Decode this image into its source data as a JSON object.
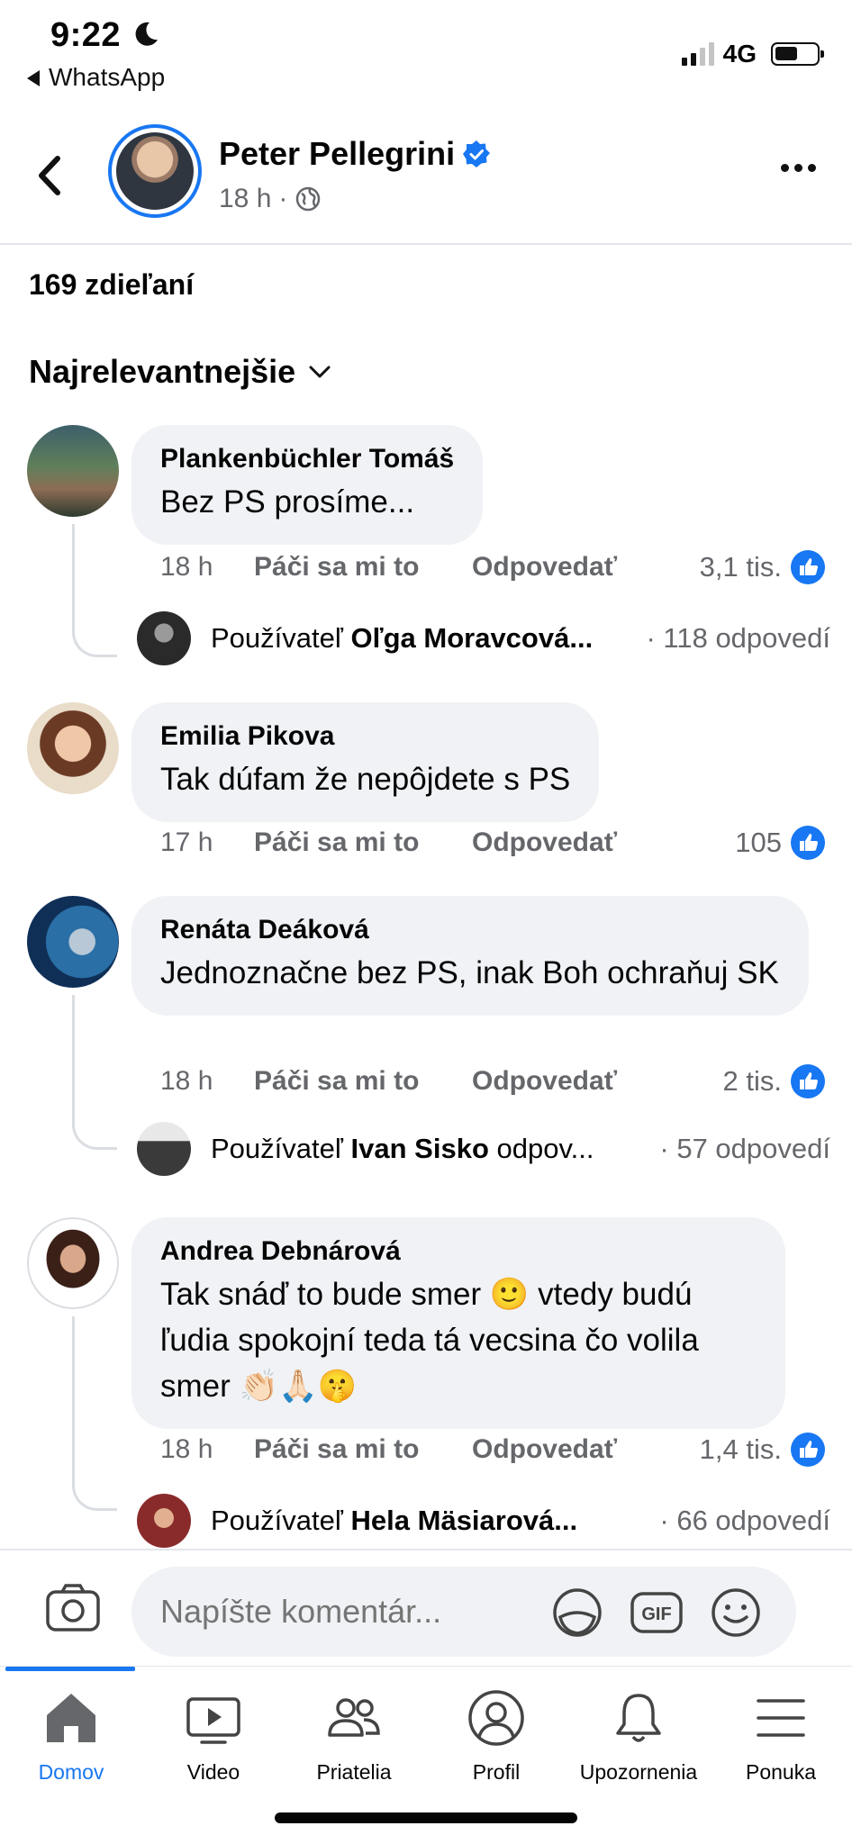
{
  "status_bar": {
    "time": "9:22",
    "back_app": "WhatsApp",
    "network": "4G"
  },
  "post": {
    "author": "Peter Pellegrini",
    "time": "18 h",
    "meta_separator": "·",
    "shares": "169 zdieľaní",
    "sort_label": "Najrelevantnejšie"
  },
  "comments": [
    {
      "author": "Plankenbüchler Tomáš",
      "text": "Bez PS prosíme...",
      "time": "18 h",
      "like_label": "Páči sa mi to",
      "reply_label": "Odpovedať",
      "reactions": "3,1 tis.",
      "reply_preview": {
        "prefix": "Používateľ",
        "name": "Oľga Moravcová...",
        "count": "· 118 odpovedí"
      }
    },
    {
      "author": "Emilia Pikova",
      "text": "Tak dúfam že nepôjdete s PS",
      "time": "17 h",
      "like_label": "Páči sa mi to",
      "reply_label": "Odpovedať",
      "reactions": "105"
    },
    {
      "author": "Renáta Deáková",
      "text": "Jednoznačne bez PS, inak Boh ochraňuj SK",
      "time": "18 h",
      "like_label": "Páči sa mi to",
      "reply_label": "Odpovedať",
      "reactions": "2 tis.",
      "reply_preview": {
        "prefix": "Používateľ",
        "name": "Ivan Sisko",
        "suffix": "odpov...",
        "count": "· 57 odpovedí"
      }
    },
    {
      "author": "Andrea Debnárová",
      "text": "Tak snáď to bude smer 🙂 vtedy budú ľudia spokojní teda tá vecsina čo volila smer 👏🏻🙏🏻🤫",
      "time": "18 h",
      "like_label": "Páči sa mi to",
      "reply_label": "Odpovedať",
      "reactions": "1,4 tis.",
      "reply_preview": {
        "prefix": "Používateľ",
        "name": "Hela Mäsiarová...",
        "count": "· 66 odpovedí"
      }
    }
  ],
  "composer": {
    "placeholder": "Napíšte komentár..."
  },
  "tabs": [
    {
      "label": "Domov",
      "icon": "home-icon",
      "active": true
    },
    {
      "label": "Video",
      "icon": "video-icon"
    },
    {
      "label": "Priatelia",
      "icon": "friends-icon"
    },
    {
      "label": "Profil",
      "icon": "profile-icon"
    },
    {
      "label": "Upozornenia",
      "icon": "bell-icon"
    },
    {
      "label": "Ponuka",
      "icon": "menu-icon"
    }
  ],
  "colors": {
    "accent": "#1877f2",
    "bubble": "#f0f2f5",
    "secondary_text": "#65676b"
  }
}
